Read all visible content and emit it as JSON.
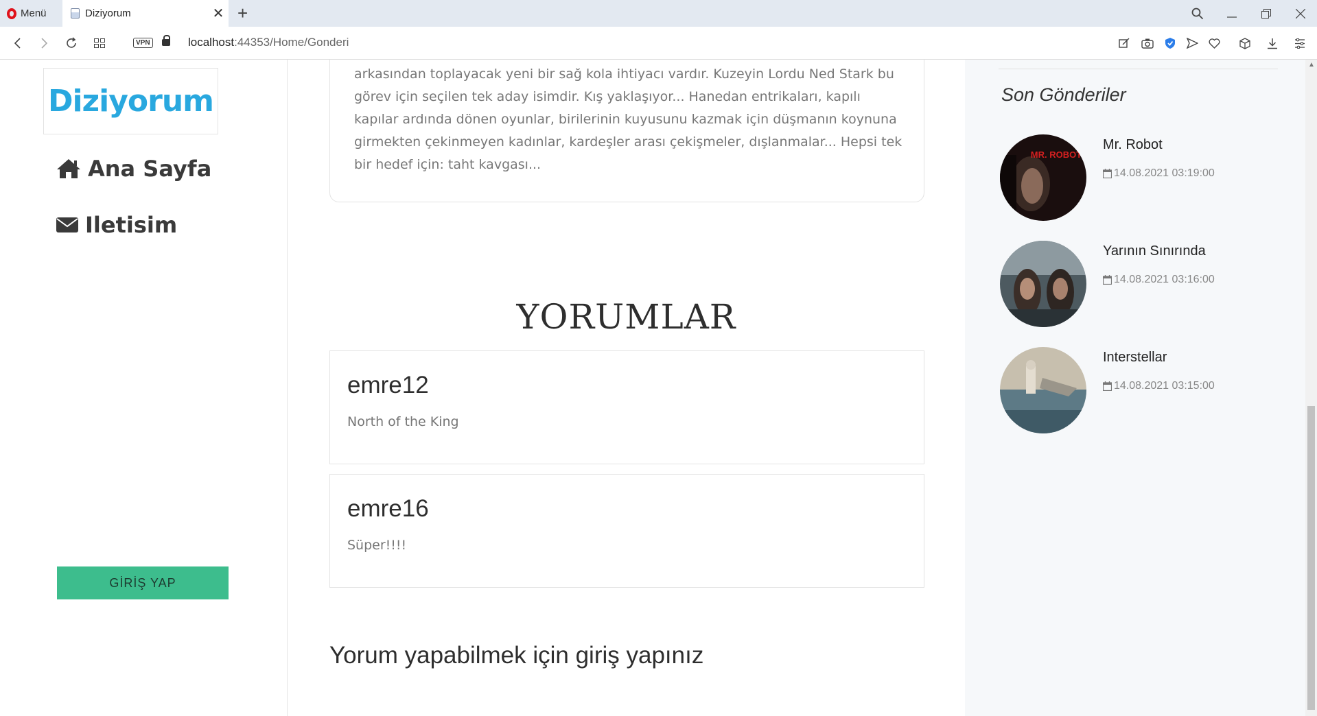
{
  "browser": {
    "menu_label": "Menü",
    "tab_title": "Diziyorum",
    "url_host": "localhost",
    "url_port_path": ":44353/Home/Gonderi",
    "vpn_label": "VPN"
  },
  "sidebar": {
    "logo": "Diziyorum",
    "nav": [
      {
        "label": "Ana Sayfa",
        "icon": "home-icon"
      },
      {
        "label": "Iletisim",
        "icon": "envelope-icon"
      }
    ],
    "login_button": "GİRİŞ YAP"
  },
  "post": {
    "excerpt": "arkasından toplayacak yeni bir sağ kola ihtiyacı vardır. Kuzeyin Lordu Ned Stark bu görev için seçilen tek aday isimdir. Kış yaklaşıyor... Hanedan entrikaları, kapılı kapılar ardında dönen oyunlar, birilerinin kuyusunu kazmak için düşmanın koynuna girmekten çekinmeyen kadınlar, kardeşler arası çekişmeler, dışlanmalar... Hepsi tek bir hedef için: taht kavgası..."
  },
  "comments": {
    "title": "YORUMLAR",
    "items": [
      {
        "user": "emre12",
        "text": "North of the King"
      },
      {
        "user": "emre16",
        "text": "Süper!!!!"
      }
    ],
    "login_note": "Yorum yapabilmek için giriş yapınız"
  },
  "recent": {
    "title": "Son Gönderiler",
    "items": [
      {
        "title": "Mr. Robot",
        "date": "14.08.2021 03:19:00",
        "thumb_text": "MR. ROBOT"
      },
      {
        "title": "Yarının Sınırında",
        "date": "14.08.2021 03:16:00"
      },
      {
        "title": "Interstellar",
        "date": "14.08.2021 03:15:00"
      }
    ]
  },
  "colors": {
    "logo": "#29a8df",
    "login_button": "#3dbd8d",
    "opera_red": "#e0121b"
  }
}
